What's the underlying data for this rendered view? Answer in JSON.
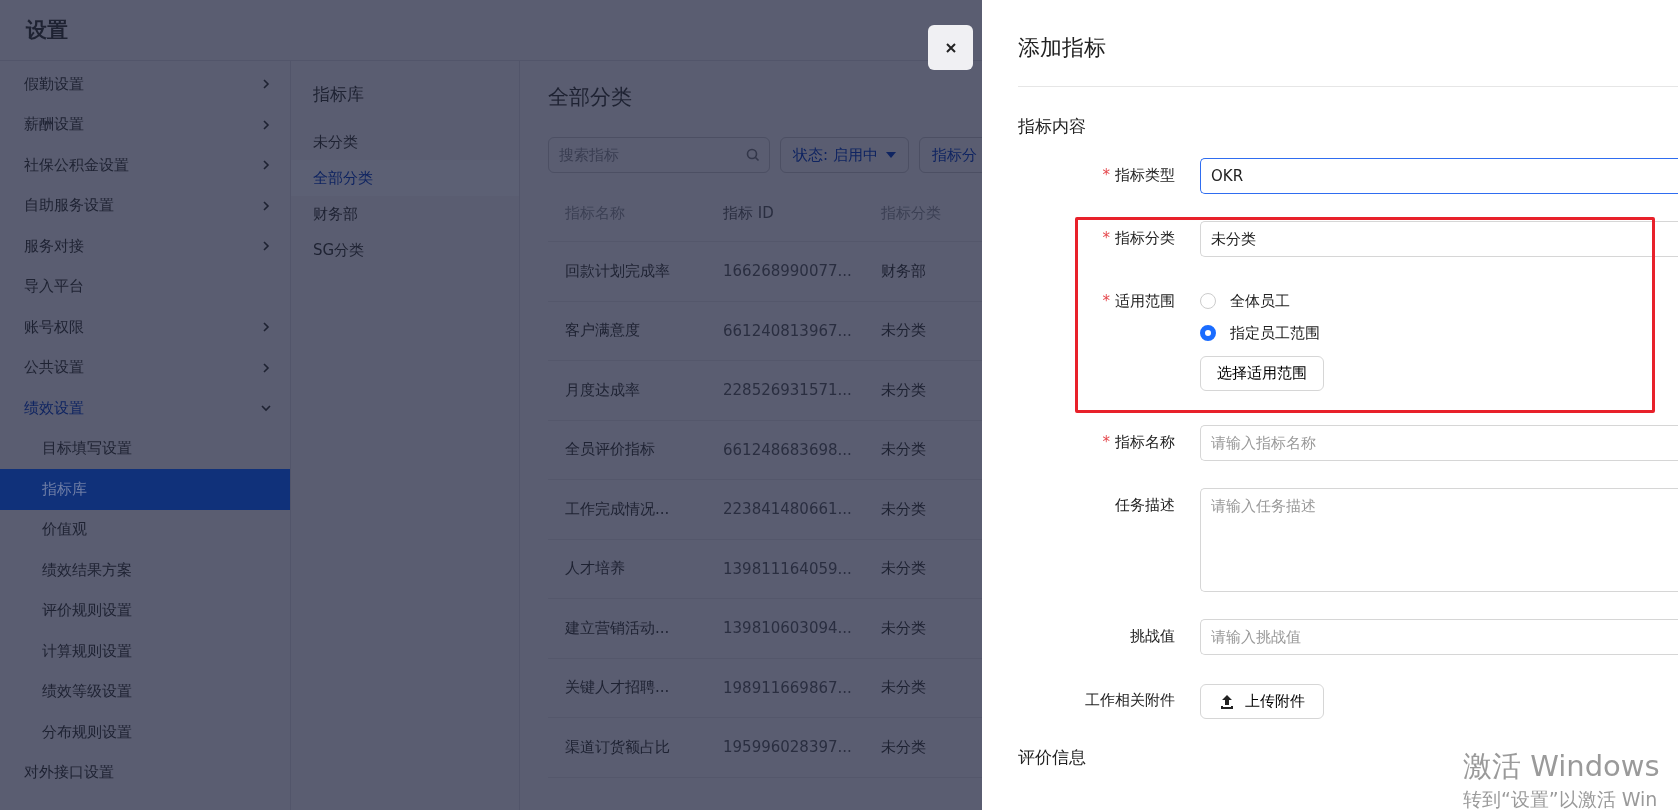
{
  "app_title": "设置",
  "sidebar": {
    "items": [
      {
        "label": "假勤设置",
        "kind": "group",
        "expanded": false
      },
      {
        "label": "薪酬设置",
        "kind": "group",
        "expanded": false
      },
      {
        "label": "社保公积金设置",
        "kind": "group",
        "expanded": false
      },
      {
        "label": "自助服务设置",
        "kind": "group",
        "expanded": false
      },
      {
        "label": "服务对接",
        "kind": "group",
        "expanded": false
      },
      {
        "label": "导入平台",
        "kind": "link"
      },
      {
        "label": "账号权限",
        "kind": "group",
        "expanded": false
      },
      {
        "label": "公共设置",
        "kind": "group",
        "expanded": false
      },
      {
        "label": "绩效设置",
        "kind": "group",
        "expanded": true,
        "children": [
          {
            "label": "目标填写设置",
            "selected": false
          },
          {
            "label": "指标库",
            "selected": true
          },
          {
            "label": "价值观",
            "selected": false
          },
          {
            "label": "绩效结果方案",
            "selected": false
          },
          {
            "label": "评价规则设置",
            "selected": false
          },
          {
            "label": "计算规则设置",
            "selected": false
          },
          {
            "label": "绩效等级设置",
            "selected": false
          },
          {
            "label": "分布规则设置",
            "selected": false
          }
        ]
      },
      {
        "label": "对外接口设置",
        "kind": "link"
      }
    ]
  },
  "category_panel": {
    "title": "指标库",
    "items": [
      {
        "label": "未分类",
        "selected": false
      },
      {
        "label": "全部分类",
        "selected": true
      },
      {
        "label": "财务部",
        "selected": false
      },
      {
        "label": "SG分类",
        "selected": false
      }
    ]
  },
  "main": {
    "title": "全部分类",
    "search": {
      "placeholder": "搜索指标"
    },
    "filters": [
      "状态: 启用中",
      "指标分"
    ],
    "table": {
      "columns": [
        "指标名称",
        "指标 ID",
        "指标分类"
      ],
      "rows": [
        [
          "回款计划完成率",
          "166268990077...",
          "财务部"
        ],
        [
          "客户满意度",
          "661240813967...",
          "未分类"
        ],
        [
          "月度达成率",
          "228526931571...",
          "未分类"
        ],
        [
          "全员评价指标",
          "661248683698...",
          "未分类"
        ],
        [
          "工作完成情况...",
          "223841480661...",
          "未分类"
        ],
        [
          "人才培养",
          "139811164059...",
          "未分类"
        ],
        [
          "建立营销活动...",
          "139810603094...",
          "未分类"
        ],
        [
          "关键人才招聘...",
          "198911669867...",
          "未分类"
        ],
        [
          "渠道订货额占比",
          "195996028397...",
          "未分类"
        ]
      ]
    }
  },
  "drawer": {
    "title": "添加指标",
    "section": "指标内容",
    "fields": [
      {
        "label": "指标类型",
        "required_mark": "*",
        "kind": "select",
        "value": "OKR",
        "focused": true
      },
      {
        "label": "指标分类",
        "required_mark": "*",
        "kind": "select",
        "value": "未分类",
        "focused": false
      },
      {
        "label": "适用范围",
        "required_mark": "*",
        "kind": "radio",
        "options": [
          {
            "label": "全体员工",
            "selected": false
          },
          {
            "label": "指定员工范围",
            "selected": true
          }
        ],
        "button": "选择适用范围"
      },
      {
        "label": "指标名称",
        "required_mark": "*",
        "kind": "input",
        "placeholder": "请输入指标名称"
      },
      {
        "label": "任务描述",
        "kind": "textarea",
        "placeholder": "请输入任务描述"
      },
      {
        "label": "挑战值",
        "kind": "input",
        "placeholder": "请输入挑战值"
      },
      {
        "label": "工作相关附件",
        "kind": "upload",
        "button": "上传附件"
      }
    ],
    "section_2": "评价信息"
  },
  "activation": {
    "title": "激活 Windows",
    "subtitle": "转到“设置”以激活 Win"
  }
}
